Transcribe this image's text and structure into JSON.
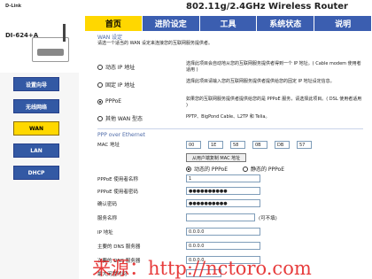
{
  "product_title": "802.11g/2.4GHz Wireless Router",
  "device_name": "DI-624+A",
  "top_tabs": [
    "首页",
    "进阶设定",
    "工具",
    "系统状态",
    "说明"
  ],
  "side_menu": [
    "设置向导",
    "无线网络",
    "WAN",
    "LAN",
    "DHCP"
  ],
  "wan": {
    "title": "WAN 设定",
    "desc": "请选一个适当的 WAN 设定来连接您的互联网服务提供者。",
    "options": [
      {
        "label": "动态 IP 地址",
        "desc": "选择此项目会自动地从您的互联网服务提供者得到一个 IP 地址。( Cable modem 使用者适用 )"
      },
      {
        "label": "固定 IP 地址",
        "desc": "选择此项目请输入您的互联网服务提供者提供给您的固定 IP 地址设定信息。"
      },
      {
        "label": "PPPoE",
        "desc": "如果您的互联网服务提供者提供给您的是 PPPoE 服务，请选择此项目。( DSL 使用者适用 )"
      },
      {
        "label": "其他 WAN 型态",
        "desc": "PPTP、BigPond Cable、L2TP 和 Telia。"
      }
    ]
  },
  "pppoe": {
    "title": "PPP over Ethernet",
    "mac_label": "MAC 地址",
    "mac": [
      "00",
      "1E",
      "58",
      "0B",
      "DB",
      "57"
    ],
    "clone_button": "从用户端复制 MAC 地址",
    "mode_dynamic": "动态的 PPPoE",
    "mode_static": "静态的 PPPoE",
    "username_label": "PPPoE 使用者名称",
    "username": "1",
    "password_label": "PPPoE 使用者密码",
    "password": "●●●●●●●●●●",
    "confirm_label": "确认密码",
    "confirm": "●●●●●●●●●●",
    "service_label": "服务名称",
    "optional": "(可不填)",
    "ip_label": "IP 地址",
    "ip": "0.0.0.0",
    "dns1_label": "主要的 DNS 服务器",
    "dns1": "0.0.0.0",
    "dns2_label": "次要的 DNS 服务器",
    "dns2": "0.0.0.0",
    "idle_label": "最大闲置时间"
  },
  "watermark": "来源：http://nctoro.com"
}
